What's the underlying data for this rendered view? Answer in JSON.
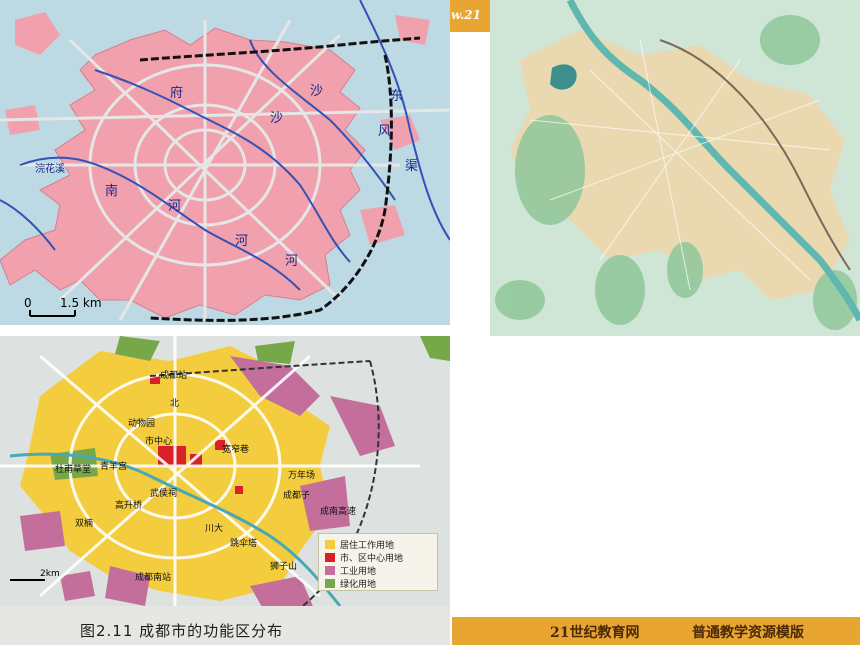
{
  "map_top_left": {
    "river_labels": [
      "府",
      "沙",
      "东",
      "风",
      "渠",
      "沙",
      "南",
      "河",
      "河",
      "河"
    ],
    "canal_label": "浣花溪",
    "scale_zero": "0",
    "scale_text": "1.5 km"
  },
  "banner_text": "w.21",
  "map_bottom_left": {
    "place_labels": [
      "成都站",
      "北",
      "动物园",
      "市中心",
      "宽窄巷",
      "杜甫草堂",
      "青羊宫",
      "万年场",
      "成都子",
      "武侯祠",
      "川大",
      "跳伞塔",
      "双楠",
      "高升桥",
      "成南高速",
      "狮子山",
      "成都南站"
    ],
    "scale_text": "2km",
    "legend": [
      {
        "label": "居住工作用地",
        "color": "#f4cd3e"
      },
      {
        "label": "市、区中心用地",
        "color": "#d9212a"
      },
      {
        "label": "工业用地",
        "color": "#c46e9c"
      },
      {
        "label": "绿化用地",
        "color": "#76a84a"
      }
    ],
    "caption": "图2.11  成都市的功能区分布"
  },
  "footer": {
    "left": "21世纪教育网",
    "right": "普通教学资源模版"
  }
}
